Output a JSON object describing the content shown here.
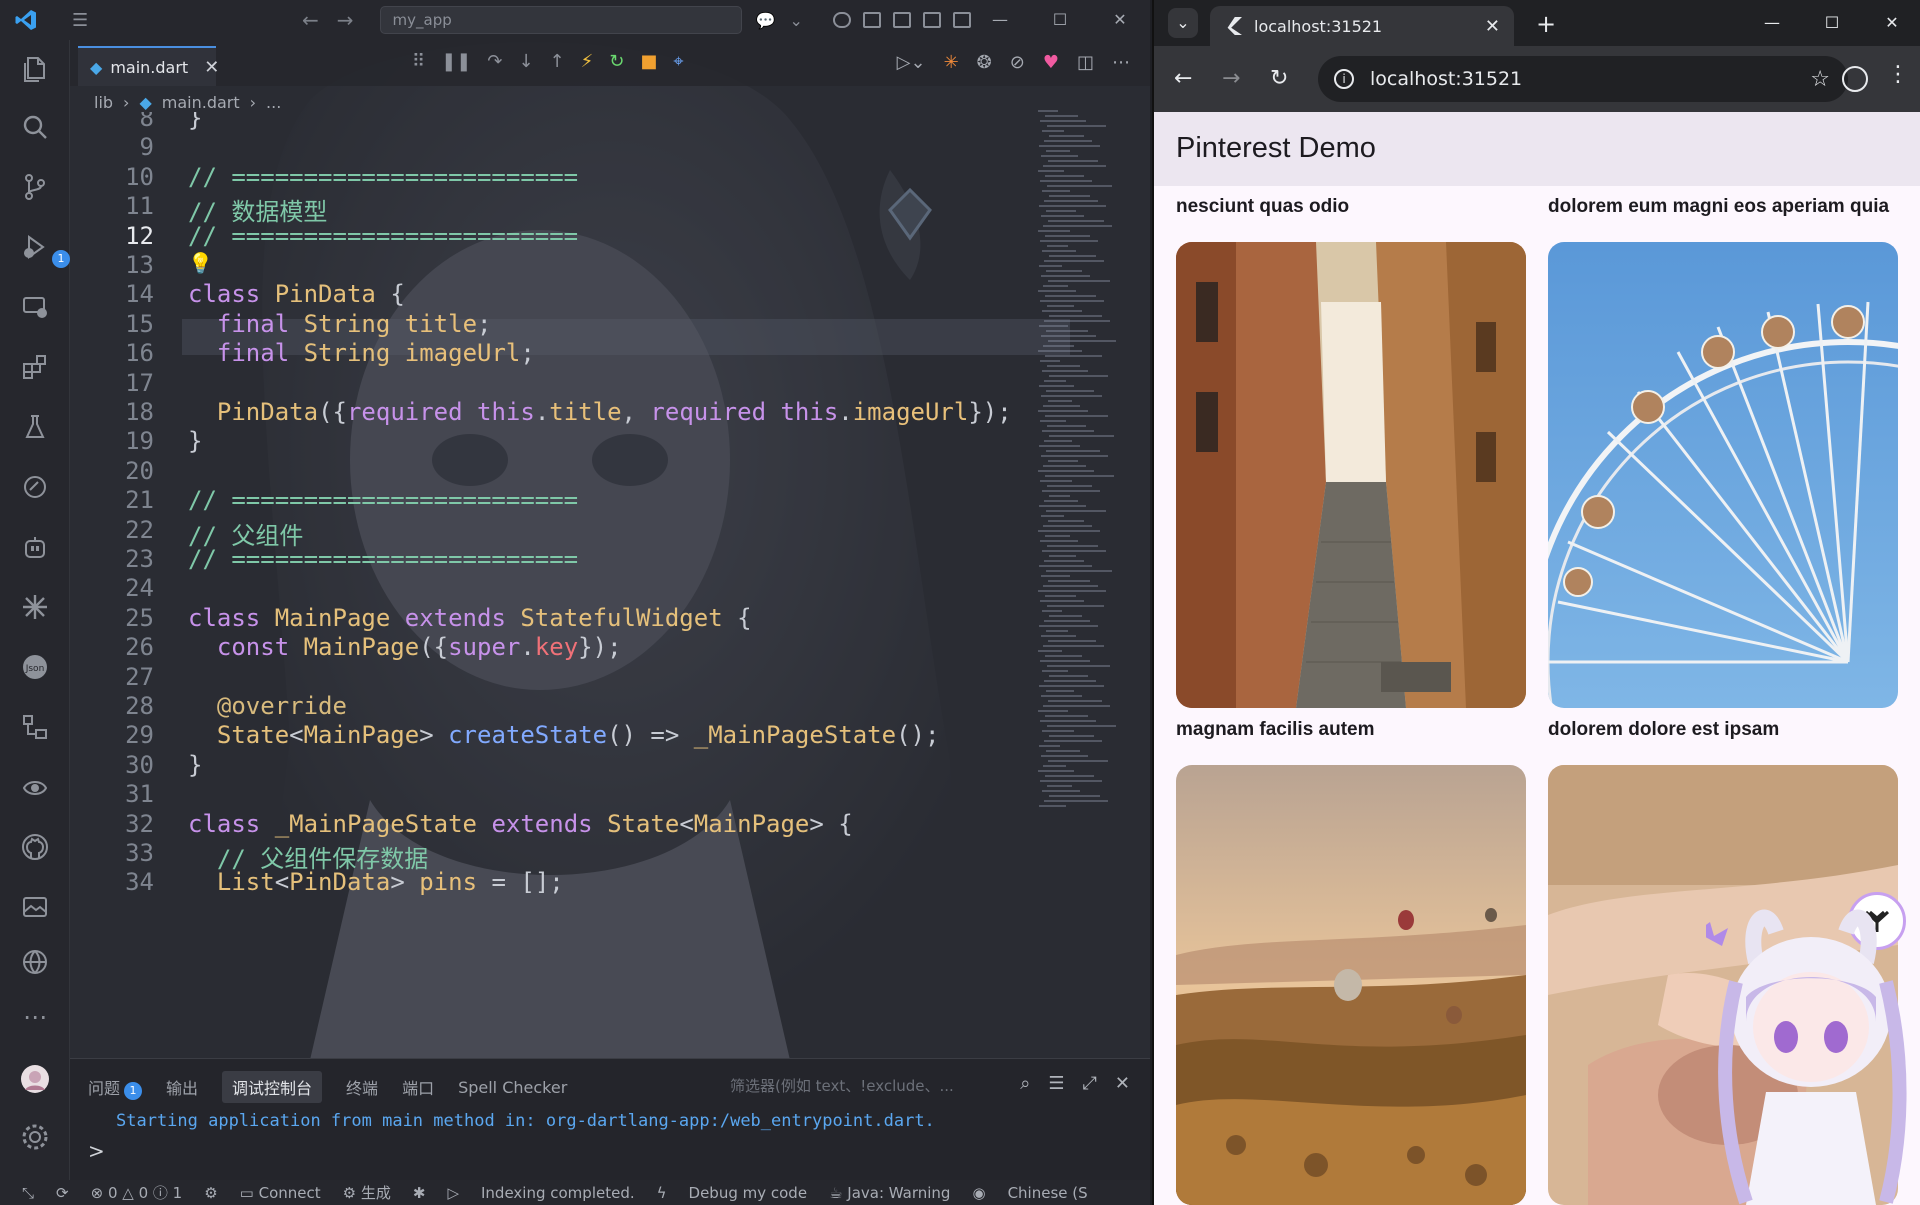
{
  "vscode": {
    "search_text": "my_app",
    "tab": {
      "label": "main.dart"
    },
    "breadcrumb": {
      "folder": "lib",
      "file": "main.dart",
      "more": "..."
    },
    "code_lines": [
      {
        "n": "8",
        "t": "}"
      },
      {
        "n": "9",
        "t": ""
      },
      {
        "n": "10",
        "t": "// ========================"
      },
      {
        "n": "11",
        "t": "// 数据模型"
      },
      {
        "n": "12",
        "t": "// ========================"
      },
      {
        "n": "13",
        "t": ""
      },
      {
        "n": "14",
        "t": "class PinData {"
      },
      {
        "n": "15",
        "t": "  final String title;"
      },
      {
        "n": "16",
        "t": "  final String imageUrl;"
      },
      {
        "n": "17",
        "t": ""
      },
      {
        "n": "18",
        "t": "  PinData({required this.title, required this.imageUrl});"
      },
      {
        "n": "19",
        "t": "}"
      },
      {
        "n": "20",
        "t": ""
      },
      {
        "n": "21",
        "t": "// ========================"
      },
      {
        "n": "22",
        "t": "// 父组件"
      },
      {
        "n": "23",
        "t": "// ========================"
      },
      {
        "n": "24",
        "t": ""
      },
      {
        "n": "25",
        "t": "class MainPage extends StatefulWidget {"
      },
      {
        "n": "26",
        "t": "  const MainPage({super.key});"
      },
      {
        "n": "27",
        "t": ""
      },
      {
        "n": "28",
        "t": "  @override"
      },
      {
        "n": "29",
        "t": "  State<MainPage> createState() => _MainPageState();"
      },
      {
        "n": "30",
        "t": "}"
      },
      {
        "n": "31",
        "t": ""
      },
      {
        "n": "32",
        "t": "class _MainPageState extends State<MainPage> {"
      },
      {
        "n": "33",
        "t": "  // 父组件保存数据"
      },
      {
        "n": "34",
        "t": "  List<PinData> pins = [];"
      }
    ],
    "active_line": "12",
    "panel": {
      "tabs": [
        "问题",
        "输出",
        "调试控制台",
        "终端",
        "端口",
        "Spell Checker"
      ],
      "problems_count": "1",
      "active_tab": "调试控制台",
      "filter_placeholder": "筛选器(例如 text、!exclude、...",
      "console_output": "Starting application from main method in: org-dartlang-app:/web_entrypoint.dart.",
      "prompt": ">"
    },
    "activity_badge": "1",
    "statusbar": {
      "errors": "0",
      "warnings": "0",
      "infos": "1",
      "connect": "Connect",
      "build": "生成",
      "indexing": "Indexing completed.",
      "debug": "Debug my code",
      "java": "Java: Warning",
      "language": "Chinese (S"
    },
    "colors": {
      "accent": "#3b8eea",
      "comment": "#7fc8a8",
      "keyword": "#c792ea",
      "type": "#e5c07b"
    }
  },
  "chrome": {
    "tab_title": "localhost:31521",
    "url": "localhost:31521",
    "app": {
      "title": "Pinterest Demo",
      "pins": [
        {
          "title": "nesciunt quas odio",
          "image": "narrow-cobblestone-alley-photo"
        },
        {
          "title": "dolorem eum magni eos aperiam quia",
          "image": "ferris-wheel-blue-sky-photo"
        },
        {
          "title": "magnam facilis autem",
          "image": "hot-air-balloons-valley-photo"
        },
        {
          "title": "dolorem dolore est ipsam",
          "image": "hands-on-desk-blurred-photo"
        }
      ]
    }
  }
}
